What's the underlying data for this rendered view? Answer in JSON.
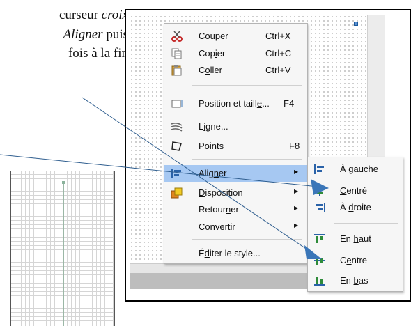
{
  "document": {
    "line1_text": "curseur ",
    "line1_italic": "croix",
    "line2_italic": "Aligner",
    "line2_text": " puis",
    "line3_text": "fois à la fin"
  },
  "context_menu": {
    "cut": {
      "pre": "",
      "ul": "C",
      "post": "ouper",
      "shortcut": "Ctrl+X",
      "icon": "scissors-icon"
    },
    "copy": {
      "pre": "Cop",
      "ul": "i",
      "post": "er",
      "shortcut": "Ctrl+C",
      "icon": "copy-icon"
    },
    "paste": {
      "pre": "C",
      "ul": "o",
      "post": "ller",
      "shortcut": "Ctrl+V",
      "icon": "clipboard-icon"
    },
    "position_size": {
      "pre": "Position et taill",
      "ul": "e",
      "post": "...",
      "shortcut": "F4",
      "icon": "position-size-icon"
    },
    "line": {
      "pre": "L",
      "ul": "i",
      "post": "gne...",
      "icon": "line-style-icon"
    },
    "points": {
      "pre": "Poi",
      "ul": "n",
      "post": "ts",
      "shortcut": "F8",
      "icon": "points-icon"
    },
    "align": {
      "pre": "Alig",
      "ul": "n",
      "post": "er",
      "icon": "align-left-icon"
    },
    "arrange": {
      "pre": "",
      "ul": "D",
      "post": "isposition",
      "icon": "arrange-icon"
    },
    "flip": {
      "pre": "Retour",
      "ul": "n",
      "post": "er"
    },
    "convert": {
      "pre": "",
      "ul": "C",
      "post": "onvertir"
    },
    "edit_style": {
      "pre": "É",
      "ul": "d",
      "post": "iter le style..."
    }
  },
  "align_submenu": {
    "left": {
      "pre": "À ",
      "ul": "g",
      "post": "auche",
      "icon": "align-left-icon"
    },
    "centered": {
      "pre": "",
      "ul": "C",
      "post": "entré",
      "icon": "align-center-horizontal-icon"
    },
    "right": {
      "pre": "À ",
      "ul": "d",
      "post": "roite",
      "icon": "align-right-icon"
    },
    "top": {
      "pre": "En ",
      "ul": "h",
      "post": "aut",
      "icon": "align-top-icon"
    },
    "middle": {
      "pre": "C",
      "ul": "e",
      "post": "ntre",
      "icon": "align-middle-icon"
    },
    "bottom": {
      "pre": "En ",
      "ul": "b",
      "post": "as",
      "icon": "align-bottom-icon"
    }
  },
  "colors": {
    "highlight": "#a6c8f2",
    "annotation_line": "#2f5e8f",
    "annotation_arrow": "#3a76b8"
  }
}
